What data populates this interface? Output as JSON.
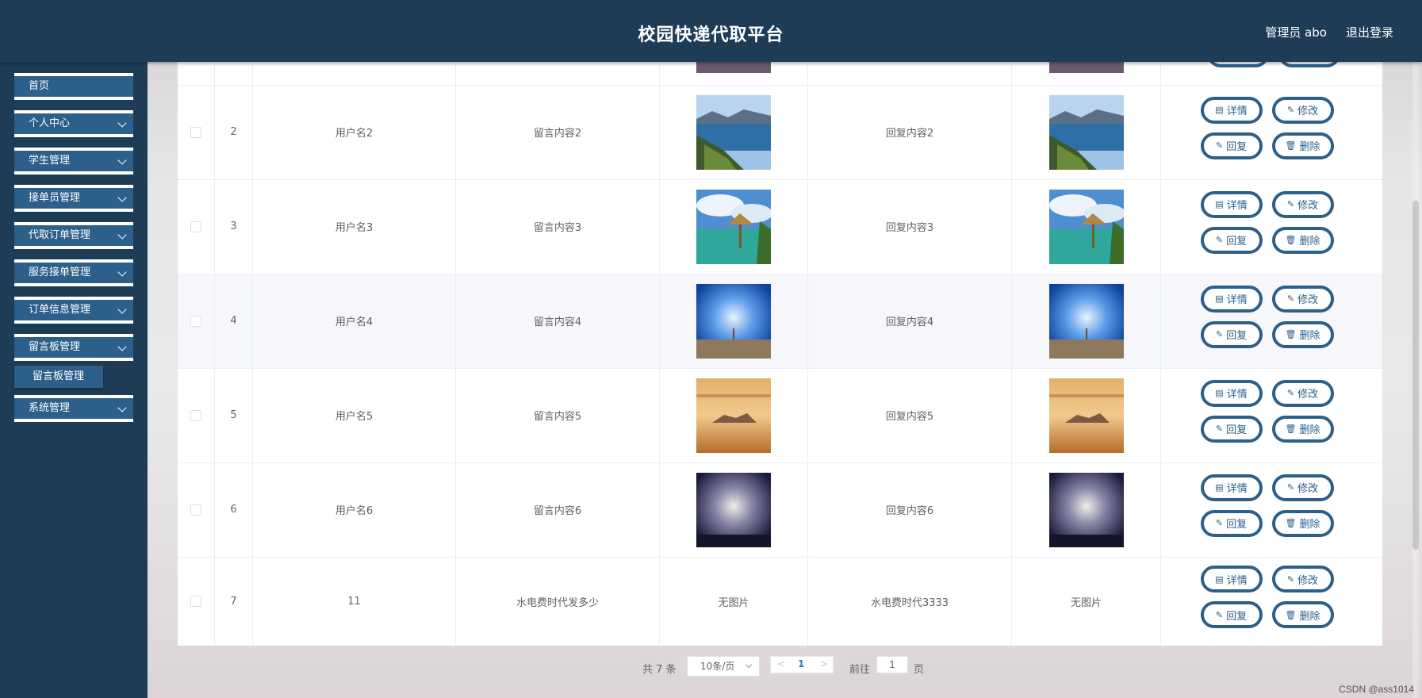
{
  "header": {
    "title": "校园快递代取平台",
    "user": "管理员 abo",
    "logout": "退出登录"
  },
  "sidebar": {
    "items": [
      {
        "label": "首页",
        "has_children": false
      },
      {
        "label": "个人中心",
        "has_children": true
      },
      {
        "label": "学生管理",
        "has_children": true
      },
      {
        "label": "接单员管理",
        "has_children": true
      },
      {
        "label": "代取订单管理",
        "has_children": true
      },
      {
        "label": "服务接单管理",
        "has_children": true
      },
      {
        "label": "订单信息管理",
        "has_children": true
      },
      {
        "label": "留言板管理",
        "has_children": true
      },
      {
        "label": "系统管理",
        "has_children": true
      }
    ],
    "submenu_label": "留言板管理"
  },
  "actions": {
    "detail": "详情",
    "edit": "修改",
    "reply": "回复",
    "delete": "删除"
  },
  "rows": [
    {
      "index": "2",
      "username": "用户名2",
      "message": "留言内容2",
      "image": "lake",
      "reply": "回复内容2",
      "reply_image": "lake"
    },
    {
      "index": "3",
      "username": "用户名3",
      "message": "留言内容3",
      "image": "beach",
      "reply": "回复内容3",
      "reply_image": "beach"
    },
    {
      "index": "4",
      "username": "用户名4",
      "message": "留言内容4",
      "image": "blue",
      "reply": "回复内容4",
      "reply_image": "blue"
    },
    {
      "index": "5",
      "username": "用户名5",
      "message": "留言内容5",
      "image": "sunset",
      "reply": "回复内容5",
      "reply_image": "sunset"
    },
    {
      "index": "6",
      "username": "用户名6",
      "message": "留言内容6",
      "image": "night",
      "reply": "回复内容6",
      "reply_image": "night"
    },
    {
      "index": "7",
      "username": "11",
      "message": "水电费时代发多少",
      "image_text": "无图片",
      "reply": "水电费时代3333",
      "reply_image_text": "无图片"
    }
  ],
  "pagination": {
    "total": "共 7 条",
    "page_size": "10条/页",
    "prev": "<",
    "current_page": "1",
    "next": ">",
    "goto_label": "前往",
    "goto_value": "1",
    "page_unit": "页"
  },
  "watermark": "CSDN @ass1014"
}
